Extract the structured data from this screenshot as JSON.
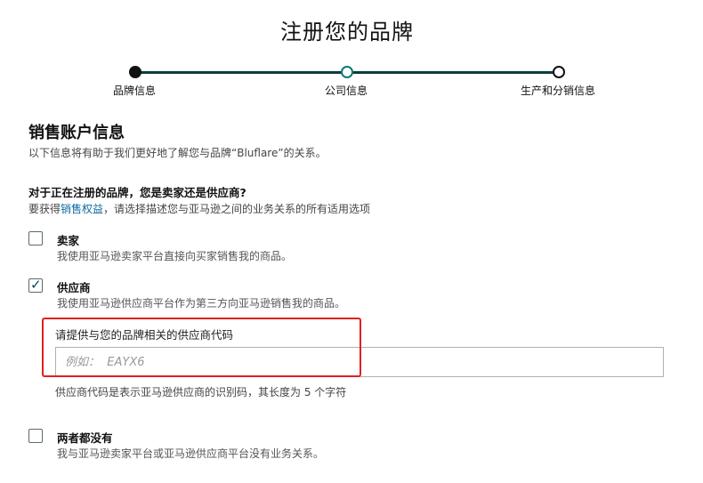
{
  "page_title": "注册您的品牌",
  "stepper": {
    "steps": [
      {
        "label": "品牌信息",
        "state": "done"
      },
      {
        "label": "公司信息",
        "state": "current"
      },
      {
        "label": "生产和分销信息",
        "state": "pending"
      }
    ]
  },
  "section": {
    "title": "销售账户信息",
    "description": "以下信息将有助于我们更好地了解您与品牌“Bluflare”的关系。"
  },
  "question": {
    "label": "对于正在注册的品牌，您是卖家还是供应商?",
    "hint_before": "要获得",
    "hint_link": "销售权益",
    "hint_after": "，请选择描述您与亚马逊之间的业务关系的所有适用选项"
  },
  "options": [
    {
      "label": "卖家",
      "description": "我使用亚马逊卖家平台直接向买家销售我的商品。",
      "checked": false
    },
    {
      "label": "供应商",
      "description": "我使用亚马逊供应商平台作为第三方向亚马逊销售我的商品。",
      "checked": true
    },
    {
      "label": "两者都没有",
      "description": "我与亚马逊卖家平台或亚马逊供应商平台没有业务关系。",
      "checked": false
    }
  ],
  "vendor_code": {
    "label": "请提供与您的品牌相关的供应商代码",
    "placeholder": "例如：  EAYX6",
    "value": "",
    "note": "供应商代码是表示亚马逊供应商的识别码，其长度为 5 个字符"
  },
  "colors": {
    "accent_link": "#0a6aa0",
    "stepper_line": "#0a3d3a",
    "highlight_border": "#e02020"
  }
}
